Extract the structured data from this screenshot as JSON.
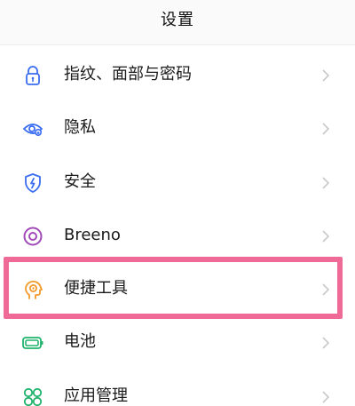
{
  "header": {
    "title": "设置"
  },
  "items": [
    {
      "label": "指纹、面部与密码",
      "icon": "lock-icon"
    },
    {
      "label": "隐私",
      "icon": "privacy-eye-icon"
    },
    {
      "label": "安全",
      "icon": "shield-icon"
    },
    {
      "label": "Breeno",
      "icon": "breeno-ring-icon"
    },
    {
      "label": "便捷工具",
      "icon": "head-target-icon",
      "highlighted": true
    },
    {
      "label": "电池",
      "icon": "battery-icon"
    },
    {
      "label": "应用管理",
      "icon": "apps-grid-icon"
    }
  ],
  "colors": {
    "icon_blue": "#3a6df0",
    "icon_purple": "#a04ab8",
    "icon_orange": "#f29a28",
    "icon_green": "#21b36b",
    "highlight_pink": "#f06a97",
    "chevron": "#c8c8c8"
  }
}
